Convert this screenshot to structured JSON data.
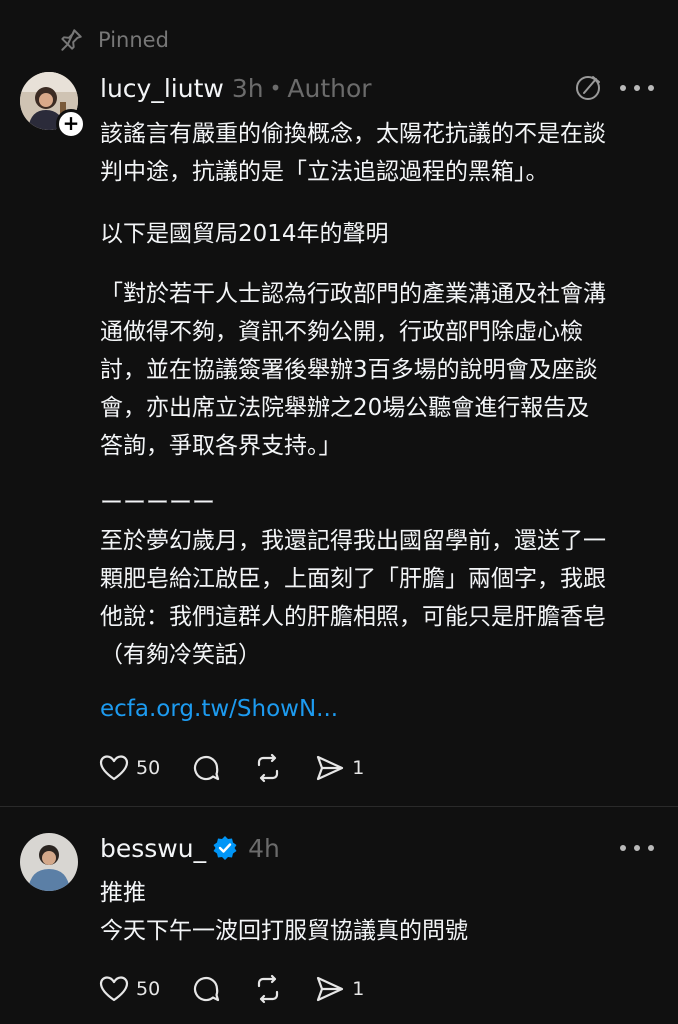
{
  "pinned_label": "Pinned",
  "post1": {
    "username": "lucy_liutw",
    "time": "3h",
    "author_badge": "Author",
    "paragraphs": [
      "該謠言有嚴重的偷換概念，太陽花抗議的不是在談\n判中途，抗議的是「立法追認過程的黑箱」。",
      "以下是國貿局2014年的聲明",
      "「對於若干人士認為行政部門的產業溝通及社會溝\n通做得不夠，資訊不夠公開，行政部門除虛心檢\n討，並在協議簽署後舉辦3百多場的說明會及座談\n會，亦出席立法院舉辦之20場公聽會進行報告及\n答詢，爭取各界支持。」",
      "ーーーーー\n至於夢幻歲月，我還記得我出國留學前，還送了一\n顆肥皂給江啟臣，上面刻了「肝膽」兩個字，我跟\n他說：我們這群人的肝膽相照，可能只是肝膽香皂\n（有夠冷笑話）"
    ],
    "link_text": "ecfa.org.tw/ShowN...",
    "likes": "50",
    "shares": "1"
  },
  "post2": {
    "username": "besswu_",
    "time": "4h",
    "text": "推推\n今天下午一波回打服貿協議真的問號",
    "likes": "50",
    "shares": "1"
  },
  "colors": {
    "background": "#101010",
    "text": "#f3f5f7",
    "muted": "#6b6b6b",
    "link": "#1d9bf0",
    "verified": "#0095f6"
  }
}
